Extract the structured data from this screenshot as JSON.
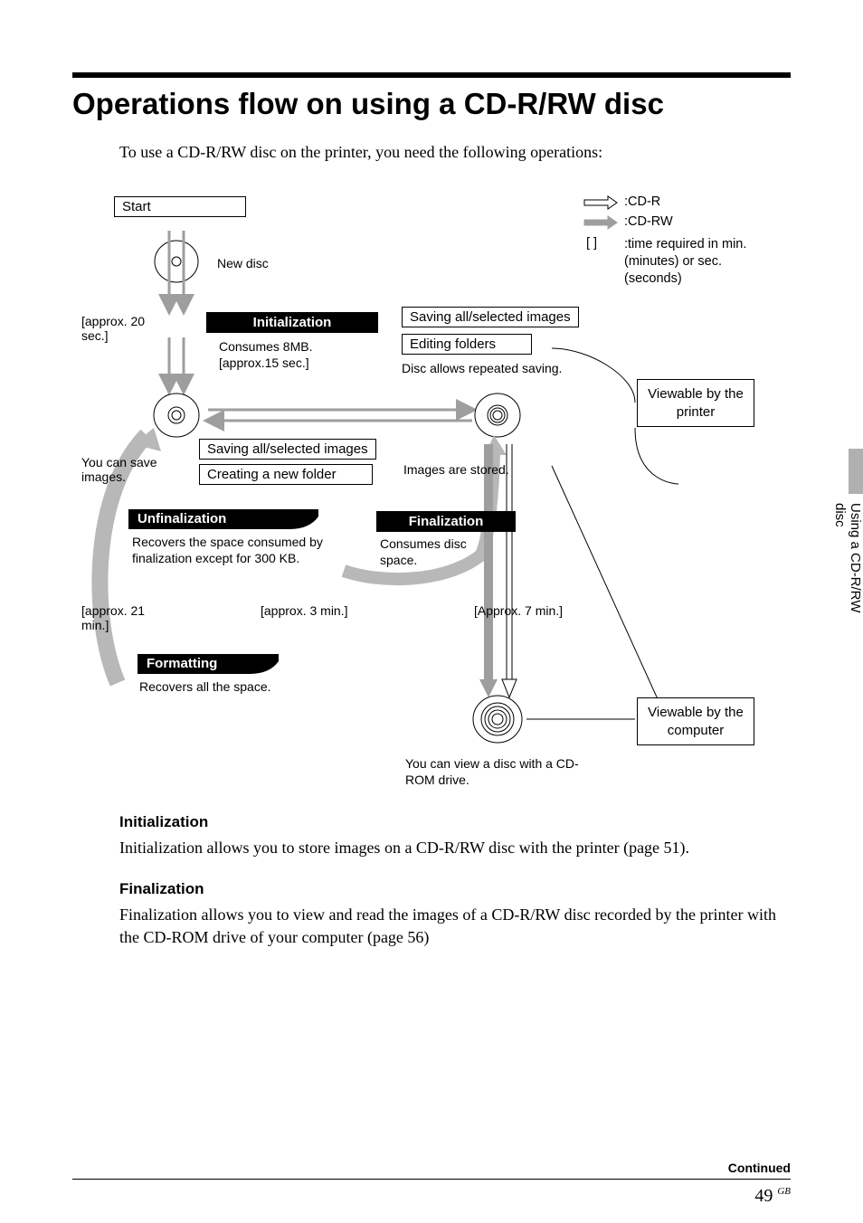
{
  "title": "Operations flow on using a CD-R/RW disc",
  "intro": "To use a CD-R/RW disc on the printer, you need the following operations:",
  "sidebar": {
    "label": "Using a CD-R/RW disc"
  },
  "legend": {
    "cdr": ":CD-R",
    "cdrw": ":CD-RW",
    "time_bracket": "[ ]",
    "time": ":time required in min. (minutes) or sec. (seconds)"
  },
  "diagram": {
    "start": "Start",
    "new_disc": "New disc",
    "approx20": "[approx. 20 sec.]",
    "init_label": "Initialization",
    "init_note1": "Consumes 8MB.",
    "init_note2": "[approx.15 sec.]",
    "saving_box": "Saving all/selected images",
    "editing_box": "Editing folders",
    "repeat_note": "Disc allows repeated saving.",
    "viewable_printer": "Viewable by the printer",
    "save_note": "You can save images.",
    "saving_box2": "Saving all/selected images",
    "create_folder": "Creating a new folder",
    "images_stored": "Images are stored.",
    "unfinal_label": "Unfinalization",
    "unfinal_note": "Recovers the space consumed by finalization except for 300 KB.",
    "approx21": "[approx. 21 min.]",
    "approx3": "[approx. 3 min.]",
    "final_label": "Finalization",
    "final_note": "Consumes disc space.",
    "approx7": "[Approx. 7 min.]",
    "format_label": "Formatting",
    "format_note": "Recovers all the space.",
    "viewable_computer": "Viewable by the computer",
    "cdrom_note": "You can view a disc with a CD-ROM drive."
  },
  "sections": {
    "init_h": "Initialization",
    "init_p": "Initialization allows you to store images on a CD-R/RW disc with the printer (page 51).",
    "final_h": "Finalization",
    "final_p": "Finalization allows you to view and read the images of a CD-R/RW disc recorded by the printer with the CD-ROM drive of your computer (page 56)"
  },
  "footer": {
    "continued": "Continued",
    "page": "49",
    "gb": "GB"
  }
}
